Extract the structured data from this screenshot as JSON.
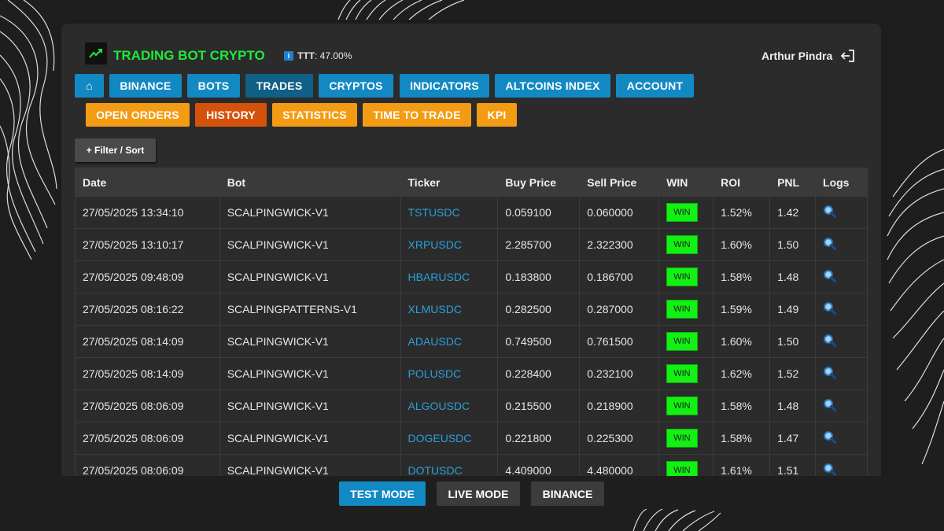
{
  "app": {
    "brand": "TRADING BOT CRYPTO",
    "ttt_label": "TTT",
    "ttt_value": ": 47.00%",
    "info_icon_char": "i",
    "user_name": "Arthur Pindra"
  },
  "nav": {
    "home": "⌂",
    "binance": "BINANCE",
    "bots": "BOTS",
    "trades": "TRADES",
    "cryptos": "CRYPTOS",
    "indicators": "INDICATORS",
    "altcoins": "ALTCOINS INDEX",
    "account": "ACCOUNT"
  },
  "subnav": {
    "open_orders": "OPEN ORDERS",
    "history": "HISTORY",
    "statistics": "STATISTICS",
    "time_to_trade": "TIME TO TRADE",
    "kpi": "KPI"
  },
  "filter": {
    "label": "+ Filter / Sort"
  },
  "table": {
    "headers": [
      "Date",
      "Bot",
      "Ticker",
      "Buy Price",
      "Sell Price",
      "WIN",
      "ROI",
      "PNL",
      "Logs"
    ],
    "rows": [
      {
        "date": "27/05/2025 13:34:10",
        "bot": "SCALPINGWICK-V1",
        "ticker": "TSTUSDC",
        "buy": "0.059100",
        "sell": "0.060000",
        "win": "WIN",
        "roi": "1.52%",
        "pnl": "1.42"
      },
      {
        "date": "27/05/2025 13:10:17",
        "bot": "SCALPINGWICK-V1",
        "ticker": "XRPUSDC",
        "buy": "2.285700",
        "sell": "2.322300",
        "win": "WIN",
        "roi": "1.60%",
        "pnl": "1.50"
      },
      {
        "date": "27/05/2025 09:48:09",
        "bot": "SCALPINGWICK-V1",
        "ticker": "HBARUSDC",
        "buy": "0.183800",
        "sell": "0.186700",
        "win": "WIN",
        "roi": "1.58%",
        "pnl": "1.48"
      },
      {
        "date": "27/05/2025 08:16:22",
        "bot": "SCALPINGPATTERNS-V1",
        "ticker": "XLMUSDC",
        "buy": "0.282500",
        "sell": "0.287000",
        "win": "WIN",
        "roi": "1.59%",
        "pnl": "1.49"
      },
      {
        "date": "27/05/2025 08:14:09",
        "bot": "SCALPINGWICK-V1",
        "ticker": "ADAUSDC",
        "buy": "0.749500",
        "sell": "0.761500",
        "win": "WIN",
        "roi": "1.60%",
        "pnl": "1.50"
      },
      {
        "date": "27/05/2025 08:14:09",
        "bot": "SCALPINGWICK-V1",
        "ticker": "POLUSDC",
        "buy": "0.228400",
        "sell": "0.232100",
        "win": "WIN",
        "roi": "1.62%",
        "pnl": "1.52"
      },
      {
        "date": "27/05/2025 08:06:09",
        "bot": "SCALPINGWICK-V1",
        "ticker": "ALGOUSDC",
        "buy": "0.215500",
        "sell": "0.218900",
        "win": "WIN",
        "roi": "1.58%",
        "pnl": "1.48"
      },
      {
        "date": "27/05/2025 08:06:09",
        "bot": "SCALPINGWICK-V1",
        "ticker": "DOGEUSDC",
        "buy": "0.221800",
        "sell": "0.225300",
        "win": "WIN",
        "roi": "1.58%",
        "pnl": "1.47"
      },
      {
        "date": "27/05/2025 08:06:09",
        "bot": "SCALPINGWICK-V1",
        "ticker": "DOTUSDC",
        "buy": "4.409000",
        "sell": "4.480000",
        "win": "WIN",
        "roi": "1.61%",
        "pnl": "1.51"
      }
    ]
  },
  "footer": {
    "test_mode": "TEST MODE",
    "live_mode": "LIVE MODE",
    "binance": "BINANCE"
  },
  "colors": {
    "brand_green": "#1fe83a",
    "nav_blue": "#1389c4",
    "nav_blue_active": "#0f5f86",
    "subnav_orange": "#f39b12",
    "subnav_orange_active": "#d6520a",
    "win_green": "#13f013",
    "ticker_blue": "#2a9fd8"
  },
  "icons": {
    "logo": "trend-up-icon",
    "info": "info-icon",
    "logout": "logout-icon",
    "logs": "magnifier-icon"
  }
}
